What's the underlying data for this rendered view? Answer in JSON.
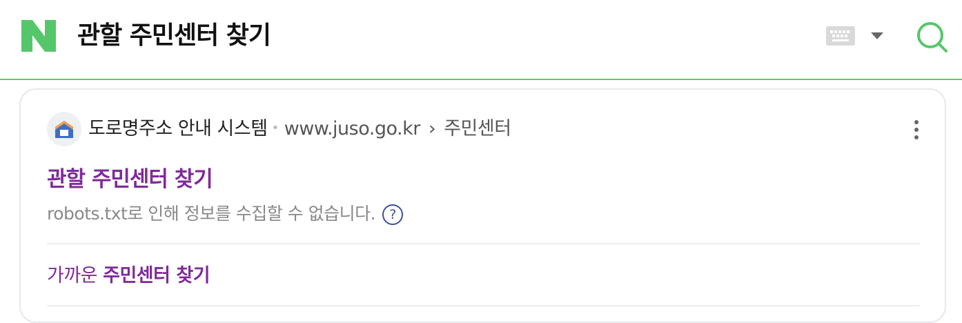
{
  "header": {
    "logo_letter": "N",
    "brand_color": "#03c75a",
    "query": "관할 주민센터 찾기",
    "keyboard_icon": "keyboard-icon",
    "dropdown_icon": "caret-down-icon",
    "search_icon": "search-icon"
  },
  "result": {
    "site_name": "도로명주소 안내 시스템",
    "url": "www.juso.go.kr",
    "breadcrumb_separator": "›",
    "path": "주민센터",
    "title": "관할 주민센터 찾기",
    "description": "robots.txt로 인해 정보를 수집할 수 없습니다.",
    "help_label": "?",
    "sublink_prefix": "가까운 ",
    "sublink_bold": "주민센터 찾기",
    "link_color": "#7f2a9a"
  }
}
